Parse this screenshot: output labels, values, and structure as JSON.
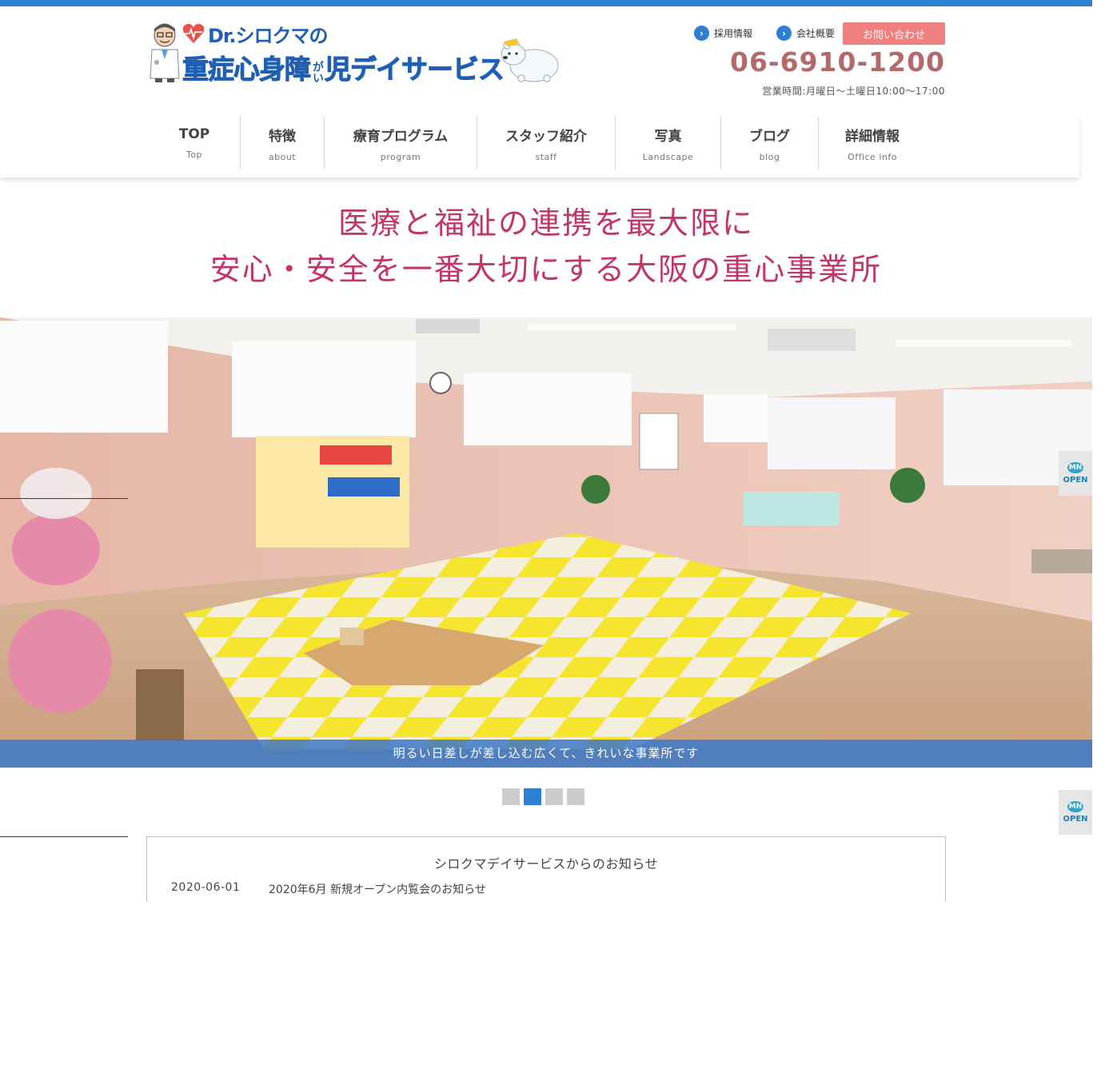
{
  "header": {
    "logo": {
      "line1": "Dr.シロクマの",
      "line2_a": "重症心身障",
      "line2_small": "がい",
      "line2_b": "児デイサービス"
    },
    "links": {
      "recruit": "採用情報",
      "company": "会社概要"
    },
    "contact_button": "お問い合わせ",
    "phone": "06-6910-1200",
    "hours": "営業時間:月曜日〜土曜日10:00〜17:00"
  },
  "nav": {
    "items": [
      {
        "jp": "TOP",
        "en": "Top"
      },
      {
        "jp": "特徴",
        "en": "about"
      },
      {
        "jp": "療育プログラム",
        "en": "program"
      },
      {
        "jp": "スタッフ紹介",
        "en": "staff"
      },
      {
        "jp": "写真",
        "en": "Landscape"
      },
      {
        "jp": "ブログ",
        "en": "blog"
      },
      {
        "jp": "詳細情報",
        "en": "Office info"
      }
    ]
  },
  "headline": {
    "line1": "医療と福祉の連携を最大限に",
    "line2": "安心・安全を一番大切にする大阪の重心事業所"
  },
  "slider": {
    "caption": "明るい日差しが差し込む広くて、きれいな事業所です",
    "active_index": 1,
    "dot_count": 4
  },
  "side_tab": {
    "badge": "MN",
    "label": "OPEN"
  },
  "news": {
    "title": "シロクマデイサービスからのお知らせ",
    "items": [
      {
        "date": "2020-06-01",
        "text": "2020年6月 新規オープン内覧会のお知らせ"
      }
    ]
  },
  "colors": {
    "accent_blue": "#2d7fd2",
    "headline_pink": "#c2346a",
    "contact_salmon": "#f08080",
    "phone_brown": "#b46a6a"
  }
}
